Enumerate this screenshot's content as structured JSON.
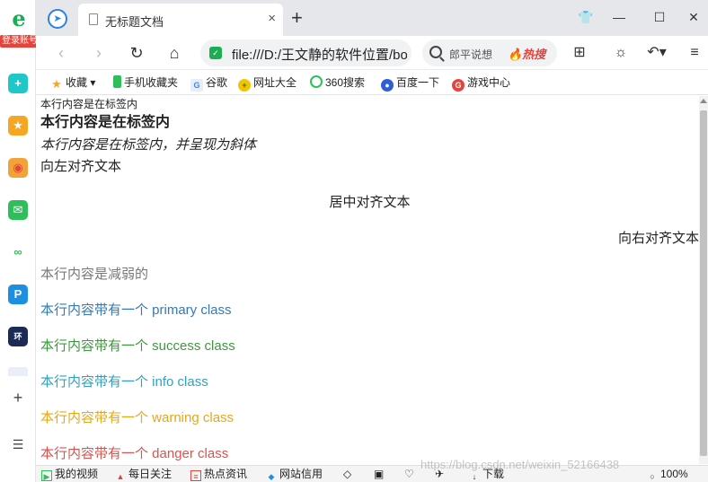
{
  "sidebar": {
    "logo_glyph": "e",
    "login_label": "登录账号",
    "apps": [
      {
        "name": "plus-app",
        "glyph": "+"
      },
      {
        "name": "favorites-app",
        "glyph": "★"
      },
      {
        "name": "weibo-app",
        "glyph": "◉"
      },
      {
        "name": "mail-app",
        "glyph": "✉"
      },
      {
        "name": "cloud-app",
        "glyph": "∞"
      },
      {
        "name": "p-app",
        "glyph": "P"
      },
      {
        "name": "news-app",
        "glyph": "环"
      }
    ],
    "add_glyph": "+",
    "menu_glyph": "☰"
  },
  "tabbar": {
    "tab_title": "无标题文档",
    "close_glyph": "×",
    "new_tab_glyph": "+"
  },
  "toolbar": {
    "url": "file:///D:/王文静的软件位置/bo",
    "search_text": "郎平说想",
    "hot_label": "🔥热搜"
  },
  "bookmarks": {
    "items": [
      {
        "label": "收藏 ▾"
      },
      {
        "label": "手机收藏夹"
      },
      {
        "label": "谷歌"
      },
      {
        "label": "网址大全"
      },
      {
        "label": "360搜索"
      },
      {
        "label": "百度一下"
      },
      {
        "label": "游戏中心"
      }
    ]
  },
  "content": {
    "small_text": "本行内容是在标签内",
    "bold_text": "本行内容是在标签内",
    "italic_text": "本行内容是在标签内，并呈现为斜体",
    "left_text": "向左对齐文本",
    "center_text": "居中对齐文本",
    "right_text": "向右对齐文本",
    "muted_text": "本行内容是减弱的",
    "primary_text": "本行内容带有一个 primary class",
    "success_text": "本行内容带有一个 success class",
    "info_text": "本行内容带有一个 info class",
    "warning_text": "本行内容带有一个 warning class",
    "danger_text": "本行内容带有一个 danger class"
  },
  "statusbar": {
    "items": [
      {
        "label": "我的视频"
      },
      {
        "label": "每日关注"
      },
      {
        "label": "热点资讯"
      },
      {
        "label": "网站信用"
      },
      {
        "label": "下载"
      },
      {
        "label": "100%"
      }
    ],
    "watermark": "https://blog.csdn.net/weixin_52166438"
  },
  "colors": {
    "muted": "#777777",
    "primary": "#337ab7",
    "success": "#3c9a3c",
    "info": "#31a2be",
    "warning": "#e7a817",
    "danger": "#d9534f"
  }
}
